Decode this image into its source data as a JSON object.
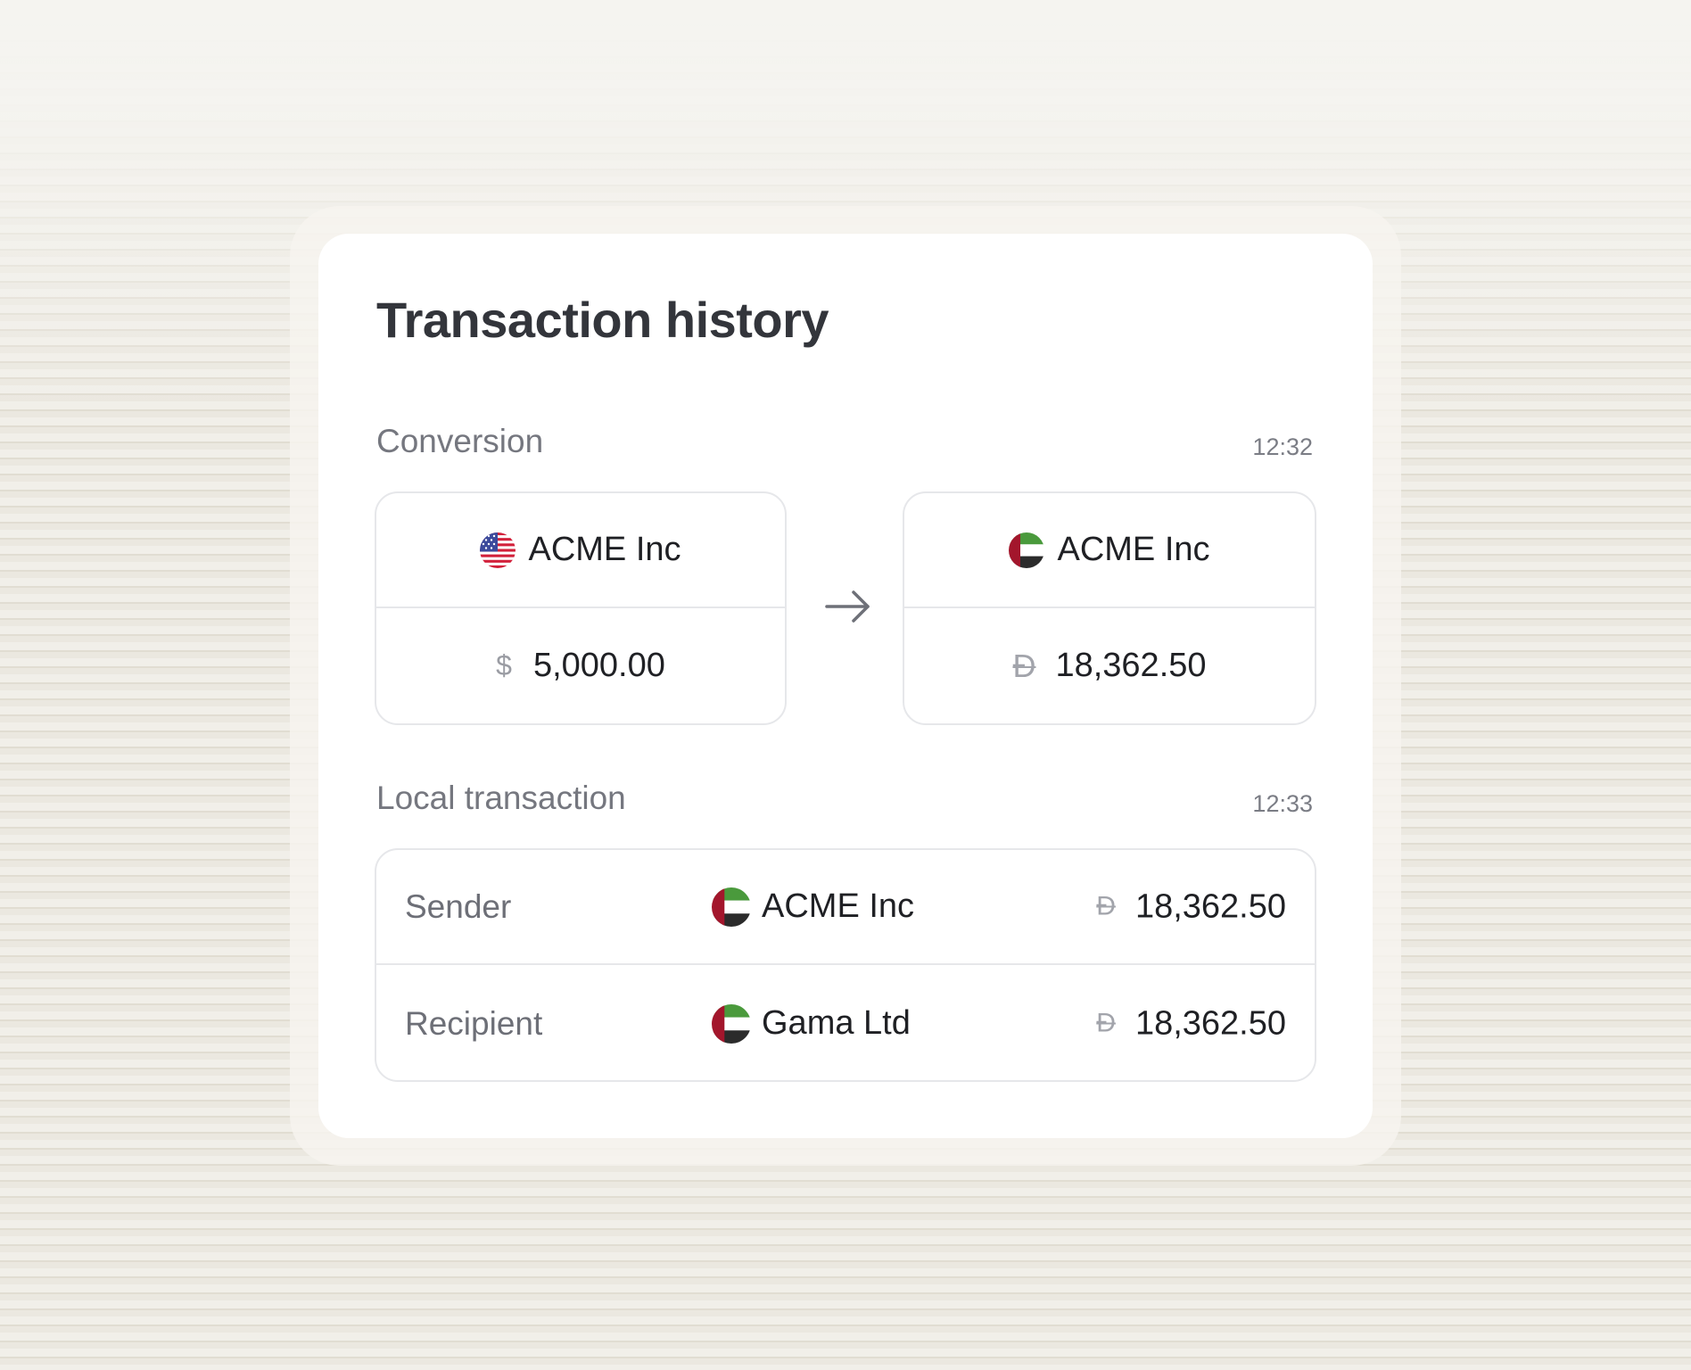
{
  "title": "Transaction history",
  "conversion": {
    "label": "Conversion",
    "time": "12:32",
    "from": {
      "name": "ACME Inc",
      "flag": "us-flag",
      "currency_symbol": "$",
      "amount": "5,000.00"
    },
    "to": {
      "name": "ACME Inc",
      "flag": "uae-flag",
      "currency_symbol": "Đ",
      "amount": "18,362.50"
    },
    "arrow": "arrow-right-icon"
  },
  "local": {
    "label": "Local transaction",
    "time": "12:33",
    "rows": [
      {
        "role": "Sender",
        "name": "ACME Inc",
        "flag": "uae-flag",
        "currency_symbol": "Đ",
        "amount": "18,362.50"
      },
      {
        "role": "Recipient",
        "name": "Gama Ltd",
        "flag": "uae-flag",
        "currency_symbol": "Đ",
        "amount": "18,362.50"
      }
    ]
  },
  "colors": {
    "text_primary": "#1f2024",
    "text_secondary": "#75777f",
    "border": "#e6e7ea",
    "uae_green": "#4a9a3c",
    "uae_red": "#a3162c",
    "uae_black": "#2b2b2b"
  }
}
